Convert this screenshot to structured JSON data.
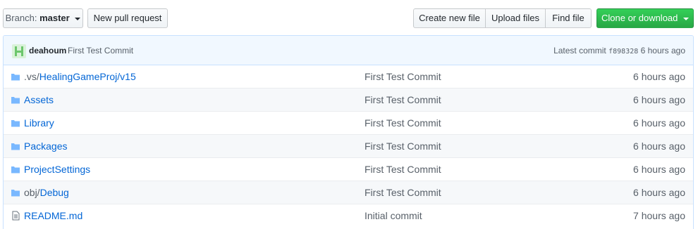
{
  "toolbar": {
    "branch_prefix": "Branch:",
    "branch_name": "master",
    "new_pr_label": "New pull request",
    "create_file_label": "Create new file",
    "upload_files_label": "Upload files",
    "find_file_label": "Find file",
    "clone_label": "Clone or download"
  },
  "commit": {
    "avatar_letter": "H",
    "author": "deahoum",
    "message": "First Test Commit",
    "latest_label": "Latest commit",
    "sha": "f898328",
    "age": "6 hours ago"
  },
  "files": [
    {
      "type": "dir",
      "prefix": ".vs/",
      "name": "HealingGameProj/v15",
      "message": "First Test Commit",
      "age": "6 hours ago"
    },
    {
      "type": "dir",
      "prefix": "",
      "name": "Assets",
      "message": "First Test Commit",
      "age": "6 hours ago"
    },
    {
      "type": "dir",
      "prefix": "",
      "name": "Library",
      "message": "First Test Commit",
      "age": "6 hours ago"
    },
    {
      "type": "dir",
      "prefix": "",
      "name": "Packages",
      "message": "First Test Commit",
      "age": "6 hours ago"
    },
    {
      "type": "dir",
      "prefix": "",
      "name": "ProjectSettings",
      "message": "First Test Commit",
      "age": "6 hours ago"
    },
    {
      "type": "dir",
      "prefix": "obj/",
      "name": "Debug",
      "message": "First Test Commit",
      "age": "6 hours ago"
    },
    {
      "type": "file",
      "prefix": "",
      "name": "README.md",
      "message": "Initial commit",
      "age": "7 hours ago"
    }
  ],
  "colors": {
    "link": "#0366d6",
    "muted": "#586069",
    "clone_green": "#2cbe4e",
    "commit_bar_bg": "#f1f8ff",
    "folder_icon": "#79b8ff"
  },
  "icons": {
    "directory": "folder-icon",
    "file": "file-icon"
  }
}
